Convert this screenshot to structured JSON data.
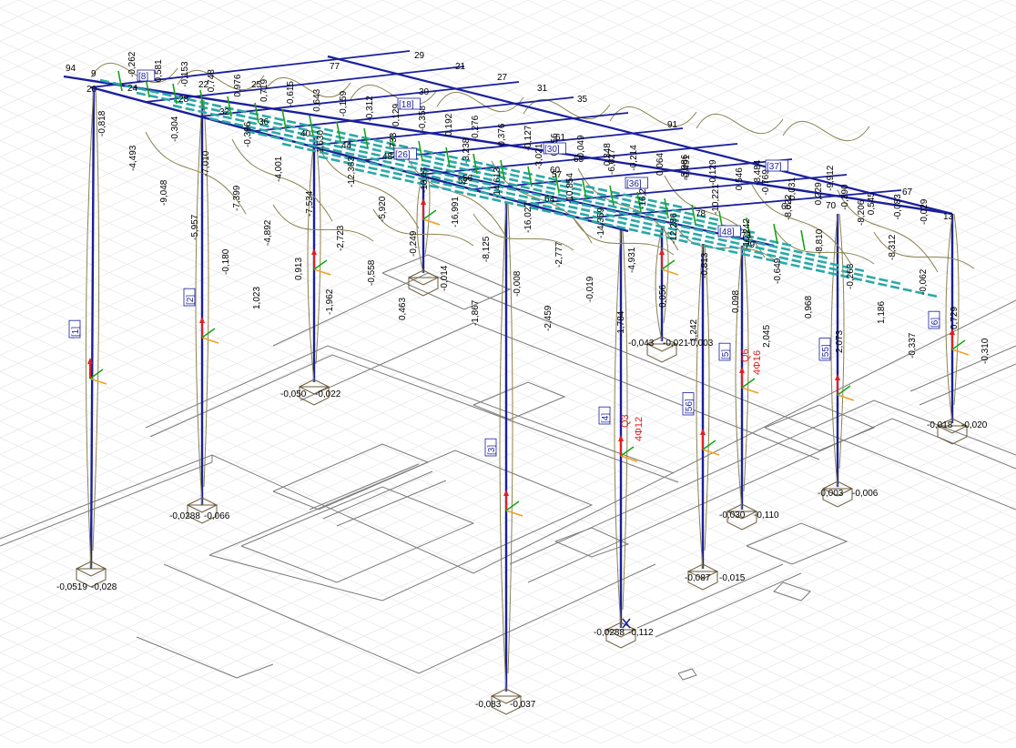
{
  "colors": {
    "background": "#ffffff",
    "grid": "#e3e3e3",
    "floor_lines": "#7a7a7a",
    "column": "#1a1f9c",
    "beam": "#1a1f9c",
    "purlin": "#2aa8a8",
    "cross_member": "#16a316",
    "moment_curve": "#8a8450",
    "value_text": "#000000",
    "tag_border": "#1a1f9c",
    "tag_text": "#1a1f9c",
    "rebar_text": "#e02020",
    "support_arrow": "#e02020",
    "axis_y": "#f0a020",
    "axis_z": "#16a316"
  },
  "node_numbers": [
    "94",
    "9",
    "20",
    "24",
    "28",
    "32",
    "36",
    "40",
    "44",
    "48",
    "77",
    "27",
    "31",
    "35",
    "29",
    "21",
    "25",
    "22",
    "30",
    "52",
    "56",
    "61",
    "65",
    "60",
    "64",
    "57",
    "91",
    "78",
    "73",
    "70",
    "66",
    "67",
    "13",
    "79"
  ],
  "member_tags": [
    "[1]",
    "[2]",
    "[3]",
    "[4]",
    "[5]",
    "[6]",
    "[8]",
    "[18]",
    "[26]",
    "[30]",
    "[36]",
    "[37]",
    "[48]",
    "[55]",
    "[56]"
  ],
  "rebar_labels": [
    "Q3",
    "4Φ12",
    "Q6",
    "4Φ16"
  ],
  "roof_values": [
    "-0,262",
    "0,581",
    "-0,153",
    "0,748",
    "0,976",
    "0,719",
    "-0,615",
    "0,643",
    "-0,159",
    "-0,312",
    "0,129",
    "-0,358",
    "0,192",
    "-0,276",
    "0,376",
    "-0,127",
    "0,556",
    "-0,049",
    "0,348",
    "-0,214",
    "0,064",
    "-0,491",
    "-0,129",
    "0,546",
    "-0,769",
    "0,031",
    "0,229",
    "-0,390",
    "0,545",
    "-0,083",
    "-0,029",
    "-0,818",
    "-0,304",
    "-0,396",
    "1,630",
    "-1,733",
    "-3,238",
    "-3,021",
    "-6,627",
    "-3,986",
    "-8,484",
    "-9,912",
    "-4,493",
    "-7,010",
    "-4,001",
    "-12,363",
    "-10,47",
    "-14,613",
    "-10,854",
    "-16,260",
    "-10,221",
    "-8,022",
    "-8,206",
    "-9,048",
    "-7,399",
    "-7,534",
    "-5,920",
    "-16,991",
    "-16,027",
    "-14,359",
    "-12,286",
    "-10,242",
    "-8,810",
    "-8,312",
    "-5,957",
    "-4,892",
    "-2,723",
    "-0,249",
    "-8,125",
    "-2,777",
    "-4,931",
    "-0,813",
    "-0,649",
    "-0,263",
    "-0,062",
    "-0,180",
    "0,913",
    "-0,558",
    "-0,014",
    "-0,008",
    "-0,019",
    "0,056",
    "0,098",
    "0,968",
    "1,186",
    "0,729",
    "1,023",
    "-1,962",
    "0,463",
    "-1,867",
    "-2,459",
    "-1,784",
    "1,242",
    "2,045",
    "2,073",
    "-0,337",
    "-0,310"
  ],
  "column_base_values": [
    "-0,0519",
    "-0,028",
    "-0,0288",
    "-0,066",
    "-0,050",
    "-0,022",
    "-0,083",
    "-0,037",
    "-0,0288",
    "-0,112",
    "-0,043",
    "-0,021",
    "-0,087",
    "-0,015",
    "-0,030",
    "-0,110",
    "-0,003",
    "-0,006",
    "-0,018",
    "-0,020",
    "-0,003"
  ]
}
